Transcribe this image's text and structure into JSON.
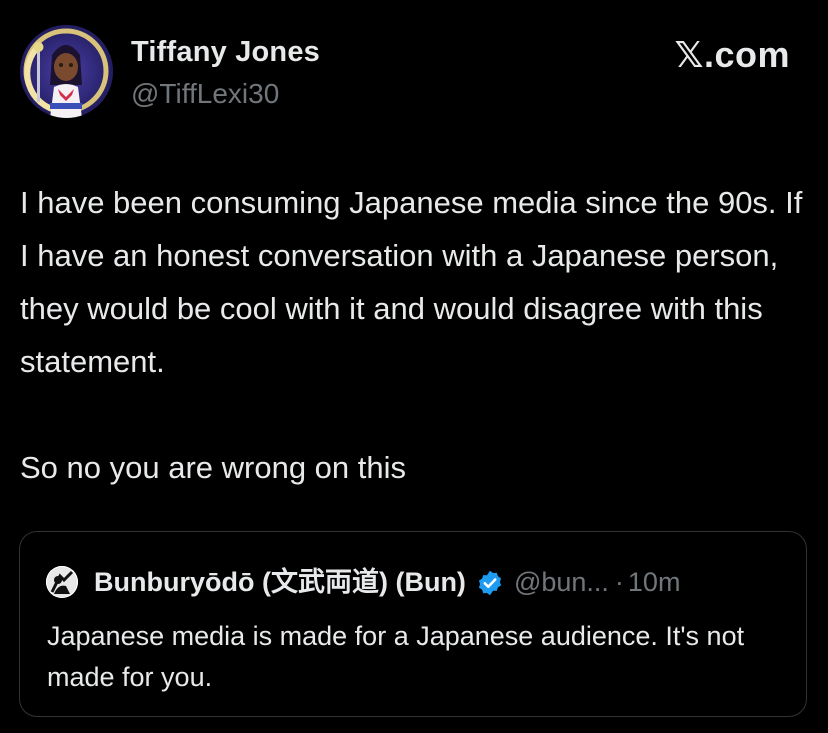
{
  "site_label": "𝕏.com",
  "author": {
    "name": "Tiffany Jones",
    "handle": "@TiffLexi30",
    "avatar_icon": "anime-character-avatar"
  },
  "post": {
    "paragraphs": [
      "I have been consuming Japanese media since the 90s. If I have an honest conversation with a Japanese person, they would be cool with it and would disagree with this statement.",
      "So no you are wrong on this"
    ]
  },
  "quoted_post": {
    "name": "Bunburyōdō (文武両道) (Bun)",
    "verified": true,
    "verified_color": "#1d9bf0",
    "handle": "@bun...",
    "separator": "·",
    "time": "10m",
    "text": "Japanese media is made for a Japanese audience. It's not made for you.",
    "avatar_icon": "samurai-avatar"
  },
  "colors": {
    "background": "#000000",
    "text_primary": "#e7e9ea",
    "text_secondary": "#71767b",
    "border": "#2f3336"
  }
}
